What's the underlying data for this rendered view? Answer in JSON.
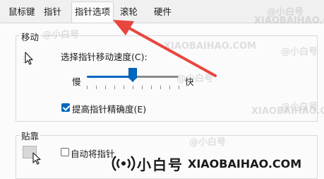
{
  "tabs": [
    {
      "label": "鼠标键",
      "active": false
    },
    {
      "label": "指针",
      "active": false
    },
    {
      "label": "指针选项",
      "active": true
    },
    {
      "label": "滚轮",
      "active": false
    },
    {
      "label": "硬件",
      "active": false
    }
  ],
  "motion": {
    "title": "移动",
    "speed_label": "选择指针移动速度(C):",
    "slow_label": "慢",
    "fast_label": "快",
    "speed_level": 0.5,
    "precision_label": "提高指针精确度(E)",
    "precision_checked": true
  },
  "snap": {
    "title": "贴靠",
    "auto_label": "自动将指针",
    "auto_checked": false
  },
  "watermarks": [
    "@小白号",
    "XIAOBAIHAO.COM",
    "@小白号",
    "XIAOBAIHAO.COM",
    "@小白号",
    "@小白号",
    "XIAOBAIHAO.COM",
    "@小白号",
    "@小白号"
  ],
  "brand": {
    "cn": "小白号",
    "en": "XIAOBAIHAO.COM"
  },
  "colors": {
    "accent": "#0067c0",
    "arrow": "#e8463e"
  },
  "icons": {
    "motion": "mouse-pointer-icon",
    "snap": "snap-pointer-icon",
    "brand": "signal-icon"
  }
}
